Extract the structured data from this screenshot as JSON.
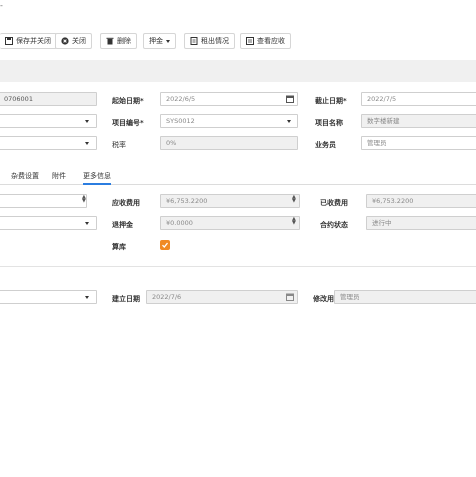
{
  "window": {
    "title_fragment": "-"
  },
  "toolbar": {
    "save_close": "保存并关闭",
    "close": "关闭",
    "delete": "删除",
    "deposit": "押金",
    "rental_status": "租出情况",
    "view_receivable": "查看应收"
  },
  "form": {
    "code_value": "0706001",
    "start_date_label": "起始日期*",
    "start_date_value": "2022/6/5",
    "end_date_label": "截止日期*",
    "end_date_value": "2022/7/5",
    "project_code_label": "项目编号*",
    "project_code_value": "SYS0012",
    "project_name_label": "项目名称",
    "project_name_value": "数字楼新建",
    "tax_rate_label": "税率",
    "tax_rate_value": "0%",
    "salesperson_label": "业务员",
    "salesperson_value": "管理员"
  },
  "tabs": [
    {
      "label": "杂费设置"
    },
    {
      "label": "附件"
    },
    {
      "label": "更多信息"
    }
  ],
  "more": {
    "receivable_label": "应收费用",
    "receivable_value": "¥6,753.2200",
    "received_label": "已收费用",
    "received_value": "¥6,753.2200",
    "deposit_back_label": "退押金",
    "deposit_back_value": "¥0.0000",
    "contract_status_label": "合约状态",
    "contract_status_value": "进行中",
    "counted_label": "算库"
  },
  "footer": {
    "created_date_label": "建立日期",
    "created_date_value": "2022/7/6",
    "modified_user_label": "修改用户",
    "modified_user_value": "管理员"
  },
  "colors": {
    "accent": "#f08a24",
    "tab_active": "#2b7de0"
  }
}
